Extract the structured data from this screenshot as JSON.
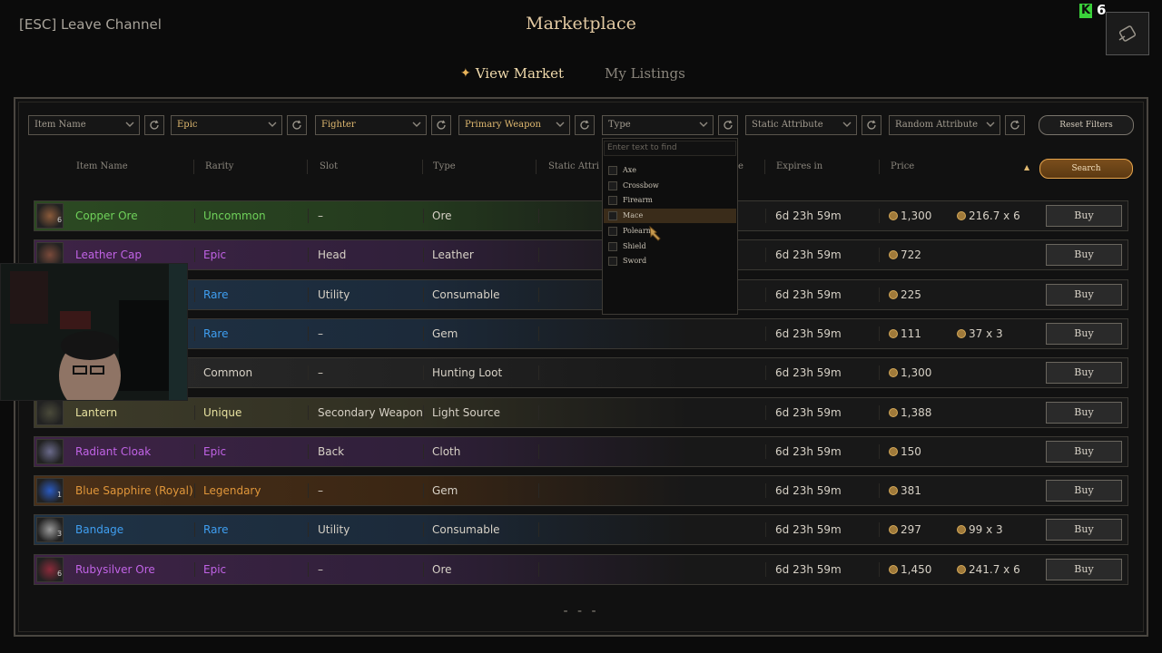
{
  "header": {
    "esc_label": "[ESC] Leave Channel",
    "title": "Marketplace",
    "badge_letter": "K",
    "badge_count": "6"
  },
  "tabs": [
    {
      "label": "View Market",
      "active": true
    },
    {
      "label": "My Listings",
      "active": false
    }
  ],
  "filters": [
    {
      "value": "Item Name",
      "active": false
    },
    {
      "value": "Epic",
      "active": true
    },
    {
      "value": "Fighter",
      "active": true
    },
    {
      "value": "Primary Weapon",
      "active": true
    },
    {
      "value": "Type",
      "active": false
    },
    {
      "value": "Static Attribute",
      "active": false
    },
    {
      "value": "Random Attribute",
      "active": false
    }
  ],
  "reset_label": "Reset Filters",
  "search_label": "Search",
  "columns": [
    "Item Name",
    "Rarity",
    "Slot",
    "Type",
    "Static Attri",
    "e",
    "Expires in",
    "Price"
  ],
  "dropdown": {
    "placeholder": "Enter text to find",
    "options": [
      "Axe",
      "Crossbow",
      "Firearm",
      "Mace",
      "Polearm",
      "Shield",
      "Sword"
    ],
    "hovered": "Mace"
  },
  "rows": [
    {
      "name": "Copper Ore",
      "qty": "6",
      "rarity": "Uncommon",
      "slot": "–",
      "type": "Ore",
      "expires": "6d 23h 59m",
      "price": "1,300",
      "unit": "216.7 x 6"
    },
    {
      "name": "Leather Cap",
      "qty": "",
      "rarity": "Epic",
      "slot": "Head",
      "type": "Leather",
      "expires": "6d 23h 59m",
      "price": "722",
      "unit": ""
    },
    {
      "name": "",
      "qty": "",
      "rarity": "Rare",
      "slot": "Utility",
      "type": "Consumable",
      "expires": "6d 23h 59m",
      "price": "225",
      "unit": ""
    },
    {
      "name": "",
      "qty": "",
      "rarity": "Rare",
      "slot": "–",
      "type": "Gem",
      "expires": "6d 23h 59m",
      "price": "111",
      "unit": "37 x 3"
    },
    {
      "name": "",
      "qty": "",
      "rarity": "Common",
      "slot": "–",
      "type": "Hunting Loot",
      "expires": "6d 23h 59m",
      "price": "1,300",
      "unit": ""
    },
    {
      "name": "Lantern",
      "qty": "",
      "rarity": "Unique",
      "slot": "Secondary Weapon",
      "type": "Light Source",
      "expires": "6d 23h 59m",
      "price": "1,388",
      "unit": ""
    },
    {
      "name": "Radiant Cloak",
      "qty": "",
      "rarity": "Epic",
      "slot": "Back",
      "type": "Cloth",
      "expires": "6d 23h 59m",
      "price": "150",
      "unit": ""
    },
    {
      "name": "Blue Sapphire (Royal)",
      "qty": "1",
      "rarity": "Legendary",
      "slot": "–",
      "type": "Gem",
      "expires": "6d 23h 59m",
      "price": "381",
      "unit": ""
    },
    {
      "name": "Bandage",
      "qty": "3",
      "rarity": "Rare",
      "slot": "Utility",
      "type": "Consumable",
      "expires": "6d 23h 59m",
      "price": "297",
      "unit": "99 x 3"
    },
    {
      "name": "Rubysilver Ore",
      "qty": "6",
      "rarity": "Epic",
      "slot": "–",
      "type": "Ore",
      "expires": "6d 23h 59m",
      "price": "1,450",
      "unit": "241.7 x 6"
    }
  ],
  "buy_label": "Buy",
  "pager_label": "- - -",
  "colors": {
    "Uncommon": "#6fd15a",
    "Epic": "#c163e6",
    "Rare": "#3f9ef0",
    "Common": "#d7d1c6",
    "Unique": "#e8e2a0",
    "Legendary": "#e0963a",
    "accent": "#e0b970"
  },
  "row_bg": {
    "Uncommon": "linear-gradient(90deg, #2c4a22 0%, #243a1e 35%, #181818 60%)",
    "Epic": "linear-gradient(90deg, #3e2346 0%, #30203a 35%, #181818 60%)",
    "Rare": "linear-gradient(90deg, #1f3346 0%, #1c2a3a 35%, #181818 60%)",
    "Common": "linear-gradient(90deg, #2a2a2a 0%, #222 35%, #181818 60%)",
    "Unique": "linear-gradient(90deg, #3e3c2a 0%, #302f22 35%, #181818 60%)",
    "Legendary": "linear-gradient(90deg, #4a3018 0%, #3a2614 35%, #181818 60%)"
  },
  "icons": {
    "corner": "lantern-icon",
    "sort": "sort-arrow-up-icon",
    "refresh": "refresh-icon",
    "chevron": "chevron-down-icon",
    "coin": "gold-coin-icon"
  }
}
